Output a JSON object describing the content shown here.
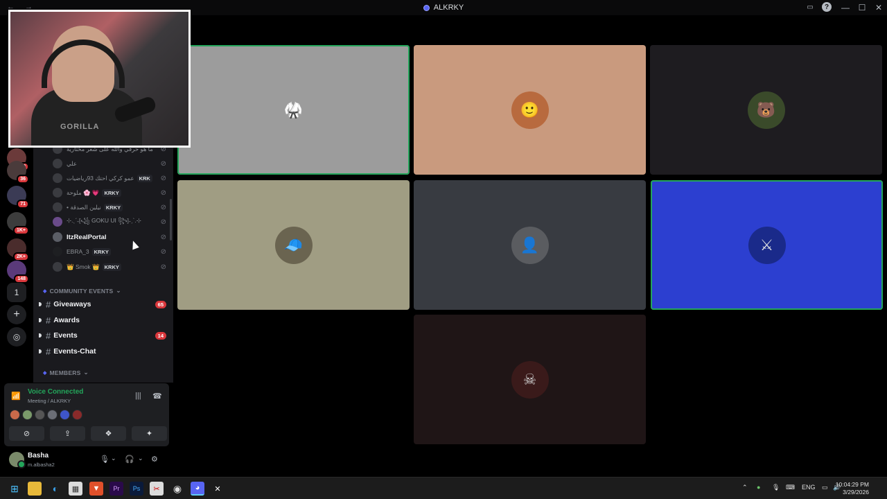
{
  "window": {
    "title": "ALKRKY",
    "back_arrows": "← →",
    "controls": [
      "—",
      "☐",
      "✕"
    ]
  },
  "servers": {
    "badges": [
      "718",
      "36",
      "71",
      "1K+",
      "2K+",
      "148"
    ],
    "number_item": "1",
    "add_icon": "plus-icon",
    "discover_icon": "compass-icon"
  },
  "voice_users": [
    {
      "name": "ما هو حرقي والله على شعر مختارية",
      "tag": ""
    },
    {
      "name": "علي",
      "tag": ""
    },
    {
      "name": "عمو كركي احتك 93رياضيات",
      "tag": "KRK"
    },
    {
      "name": "ملوحة 🌸 💗",
      "tag": "KRKY"
    },
    {
      "name": "• نيلين الصدقة",
      "tag": "KRKY"
    },
    {
      "name": "⊹.ˎˊ˗[꧁ GOKU UI ꧂]˗ˏˋ.⊹",
      "tag": ""
    },
    {
      "name": "ItzRealPortal",
      "tag": ""
    },
    {
      "name": "EBRA_3",
      "tag": "KRKY"
    },
    {
      "name": "👑 Smok 👑",
      "tag": "KRKY"
    }
  ],
  "categories": {
    "community_events": "COMMUNITY EVENTS",
    "members": "MEMBERS"
  },
  "channels": [
    {
      "name": "Giveaways",
      "count": "65"
    },
    {
      "name": "Awards",
      "count": ""
    },
    {
      "name": "Events",
      "count": "14"
    },
    {
      "name": "Events-Chat",
      "count": ""
    }
  ],
  "voice_panel": {
    "status": "Voice Connected",
    "sub": "Meeting / ALKRKY"
  },
  "user": {
    "name": "Basha",
    "handle": "m.albasha2"
  },
  "webcam": {
    "shirt_text": "GORILLA"
  },
  "tiles": [
    {
      "bg": "#9c9c9c",
      "avatar": "goku-avatar",
      "speaking": true
    },
    {
      "bg": "#c99a7e",
      "avatar": "man-avatar",
      "speaking": false
    },
    {
      "bg": "#1e1c20",
      "avatar": "bear-avatar",
      "speaking": false
    },
    {
      "bg": "#a09d83",
      "avatar": "man-cap-avatar",
      "speaking": false
    },
    {
      "bg": "#383b41",
      "avatar": "hooded-avatar",
      "speaking": false
    },
    {
      "bg": "#2c3fd0",
      "avatar": "anime-avatar",
      "speaking": true
    },
    {
      "bg": "#1f1516",
      "avatar": "venom-avatar",
      "speaking": false
    }
  ],
  "taskbar": {
    "lang": "ENG",
    "time": "10:04:29 PM",
    "date": "3/29/2026"
  }
}
